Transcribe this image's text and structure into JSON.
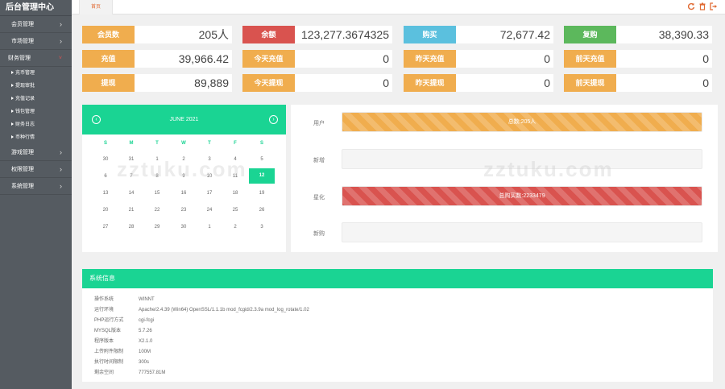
{
  "brand": "后台管理中心",
  "sidebar": {
    "groups": [
      {
        "label": "会员管理"
      },
      {
        "label": "市场管理"
      },
      {
        "label": "财务管理",
        "open": true,
        "items": [
          "充币管理",
          "提现审批",
          "充值记录",
          "钱包管理",
          "财务日志",
          "币种行情"
        ]
      },
      {
        "label": "游戏管理"
      },
      {
        "label": "权限管理"
      },
      {
        "label": "系统管理"
      }
    ]
  },
  "topbar": {
    "home_tab": "首页"
  },
  "stats": [
    {
      "label": "会员数",
      "value": "205人",
      "color": "#f0ad4e"
    },
    {
      "label": "余额",
      "value": "123,277.3674325",
      "color": "#d9534f"
    },
    {
      "label": "购买",
      "value": "72,677.42",
      "color": "#5bc0de"
    },
    {
      "label": "复购",
      "value": "38,390.33",
      "color": "#5cb85c"
    },
    {
      "label": "充值",
      "value": "39,966.42",
      "color": "#f0ad4e"
    },
    {
      "label": "今天充值",
      "value": "0",
      "color": "#f0ad4e"
    },
    {
      "label": "昨天充值",
      "value": "0",
      "color": "#f0ad4e"
    },
    {
      "label": "前天充值",
      "value": "0",
      "color": "#f0ad4e"
    },
    {
      "label": "提现",
      "value": "89,889",
      "color": "#f0ad4e"
    },
    {
      "label": "今天提现",
      "value": "0",
      "color": "#f0ad4e"
    },
    {
      "label": "昨天提现",
      "value": "0",
      "color": "#f0ad4e"
    },
    {
      "label": "前天提现",
      "value": "0",
      "color": "#f0ad4e"
    }
  ],
  "calendar": {
    "title": "JUNE 2021",
    "prev": "‹",
    "next": "›",
    "dow": [
      "S",
      "M",
      "T",
      "W",
      "T",
      "F",
      "S"
    ],
    "weeks": [
      [
        "30",
        "31",
        "1",
        "2",
        "3",
        "4",
        "5"
      ],
      [
        "6",
        "7",
        "8",
        "9",
        "10",
        "11",
        "12"
      ],
      [
        "13",
        "14",
        "15",
        "16",
        "17",
        "18",
        "19"
      ],
      [
        "20",
        "21",
        "22",
        "23",
        "24",
        "25",
        "26"
      ],
      [
        "27",
        "28",
        "29",
        "30",
        "1",
        "2",
        "3"
      ]
    ],
    "selected": "12"
  },
  "progress": [
    {
      "label": "用户",
      "text": "总数:205人",
      "fraction": 1.0,
      "style": "orange"
    },
    {
      "label": "新增",
      "text": "",
      "fraction": 0,
      "style": "orange"
    },
    {
      "label": "星化",
      "text": "总购买数:2233479",
      "fraction": 1.0,
      "style": "red"
    },
    {
      "label": "新购",
      "text": "",
      "fraction": 0,
      "style": "red"
    }
  ],
  "sysinfo": {
    "title": "系统信息",
    "rows": [
      {
        "k": "操作系统",
        "v": "WINNT"
      },
      {
        "k": "运行环境",
        "v": "Apache/2.4.39 (Win64) OpenSSL/1.1.1b mod_fcgid/2.3.9a mod_log_rotate/1.02"
      },
      {
        "k": "PHP运行方式",
        "v": "cgi-fcgi"
      },
      {
        "k": "MYSQL版本",
        "v": "5.7.26"
      },
      {
        "k": "程序版本",
        "v": "X2.1.0"
      },
      {
        "k": "上传附件限制",
        "v": "100M"
      },
      {
        "k": "执行时间限制",
        "v": "300s"
      },
      {
        "k": "剩余空间",
        "v": "777557.81M"
      }
    ]
  },
  "watermark": "zztuku.com",
  "colors": {
    "accent": "#1ad493",
    "sidebar": "#555b61"
  }
}
